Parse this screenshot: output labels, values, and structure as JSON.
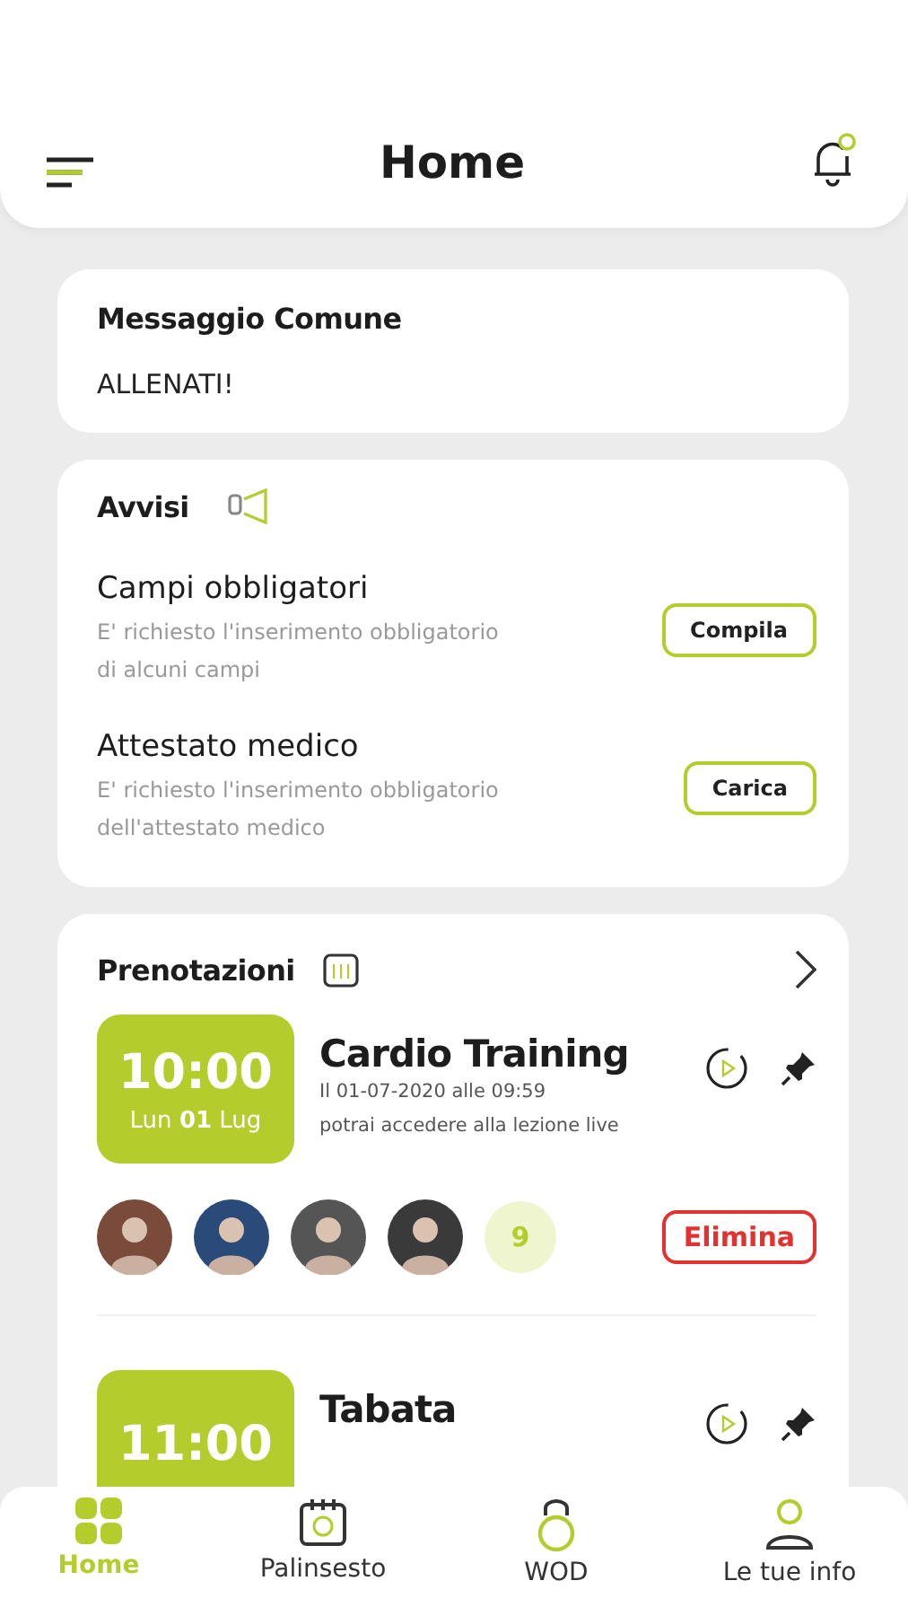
{
  "header": {
    "title": "Home"
  },
  "message": {
    "title": "Messaggio Comune",
    "text": "ALLENATI!"
  },
  "notices": {
    "title": "Avvisi",
    "items": [
      {
        "title": "Campi obbligatori",
        "text": "E' richiesto l'inserimento obbligatorio di alcuni campi",
        "action": "Compila"
      },
      {
        "title": "Attestato medico",
        "text": "E' richiesto l'inserimento obbligatorio dell'attestato medico",
        "action": "Carica"
      }
    ]
  },
  "bookings": {
    "title": "Prenotazioni",
    "items": [
      {
        "time": "10:00",
        "day": "Lun",
        "date": "01",
        "month": "Lug",
        "title": "Cardio Training",
        "lines": [
          "Il 01-07-2020 alle 09:59",
          "potrai accedere alla lezione live"
        ],
        "avatars": [
          {
            "kind": "avatar"
          },
          {
            "kind": "avatar"
          },
          {
            "kind": "avatar"
          },
          {
            "kind": "avatar"
          }
        ],
        "more": "9",
        "action": "Elimina"
      },
      {
        "time": "11:00",
        "title": "Tabata"
      }
    ]
  },
  "nav": [
    {
      "label": "Home",
      "selected": true
    },
    {
      "label": "Palinsesto",
      "selected": false
    },
    {
      "label": "WOD",
      "selected": false
    },
    {
      "label": "Le tue info",
      "selected": false
    }
  ]
}
